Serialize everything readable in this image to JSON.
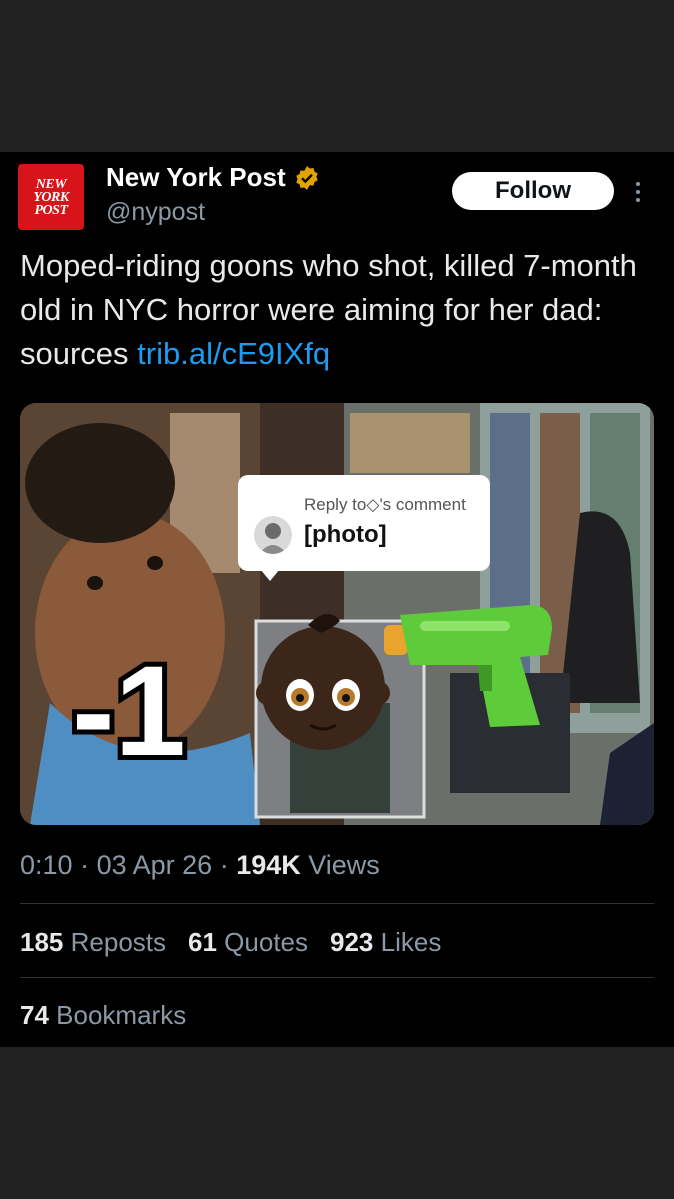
{
  "account": {
    "logo_lines": [
      "NEW",
      "YORK",
      "POST"
    ],
    "name": "New York Post",
    "handle": "@nypost",
    "follow_label": "Follow"
  },
  "tweet": {
    "text": "Moped-riding goons who shot, killed 7-month old in NYC horror were aiming for her dad: sources ",
    "link": "trib.al/cE9IXfq"
  },
  "overlay": {
    "sticker_text": "-1",
    "reply_label": "Reply to◇'s comment",
    "reply_content": "[photo]"
  },
  "meta": {
    "time": "0:10",
    "date": "03 Apr 26",
    "views_count": "194K",
    "views_label": "Views"
  },
  "stats": {
    "reposts_count": "185",
    "reposts_label": "Reposts",
    "quotes_count": "61",
    "quotes_label": "Quotes",
    "likes_count": "923",
    "likes_label": "Likes",
    "bookmarks_count": "74",
    "bookmarks_label": "Bookmarks"
  },
  "colors": {
    "accent": "#1d9bf0",
    "brand": "#d7141a",
    "verified": "#e0a300",
    "background": "#000000"
  },
  "icons": [
    "verified-badge-icon",
    "more-options-icon",
    "baby-emoji-icon",
    "water-pistol-emoji-icon"
  ]
}
